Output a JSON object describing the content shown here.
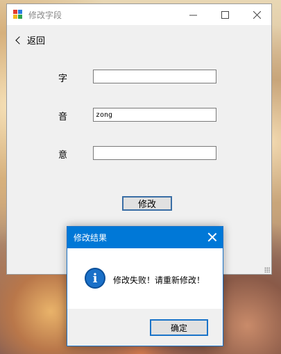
{
  "window": {
    "title": "修改字段",
    "back_label": "返回",
    "fields": [
      {
        "label": "字",
        "value": ""
      },
      {
        "label": "音",
        "value": "zong"
      },
      {
        "label": "意",
        "value": ""
      }
    ],
    "modify_label": "修改"
  },
  "dialog": {
    "title": "修改结果",
    "message": "修改失败！请重新修改！",
    "ok_label": "确定"
  },
  "colors": {
    "accent": "#0078d7",
    "window_bg": "#f0f0f0",
    "info_icon": "#1a70c8"
  }
}
